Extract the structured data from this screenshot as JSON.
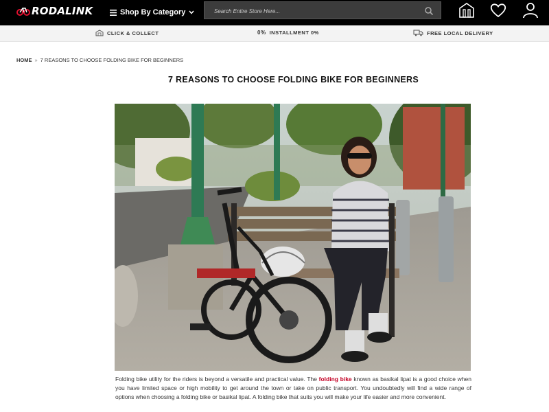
{
  "header": {
    "logo_text": "RODALINK",
    "category_label": "Shop By Category",
    "search_placeholder": "Search Entire Store Here...",
    "icons": [
      "store-icon",
      "heart-icon",
      "user-icon"
    ]
  },
  "strip": {
    "items": [
      {
        "icon": "store-small-icon",
        "label": "CLICK & COLLECT"
      },
      {
        "icon": "percent-icon",
        "prefix": "0%",
        "label": "INSTALLMENT 0%"
      },
      {
        "icon": "truck-icon",
        "label": "FREE LOCAL DELIVERY"
      }
    ]
  },
  "breadcrumb": {
    "home": "HOME",
    "separator": "»",
    "current": "7 REASONS TO CHOOSE FOLDING BIKE FOR BEGINNERS"
  },
  "article": {
    "title": "7 REASONS TO CHOOSE FOLDING BIKE FOR BEGINNERS",
    "para_before": "Folding bike utility for the riders is beyond a versatile and practical value. The ",
    "para_link": "folding bike",
    "para_after": " known as basikal lipat is a good choice when you have limited space or high mobility to get around the town or take on public transport. You undoubtedly will find a wide range of options when choosing a folding bike or basikal lipat. A folding bike that suits you will make your life easier and more convenient."
  },
  "colors": {
    "header_bg": "#000000",
    "strip_bg": "#f3f3f3",
    "accent": "#c40024"
  }
}
